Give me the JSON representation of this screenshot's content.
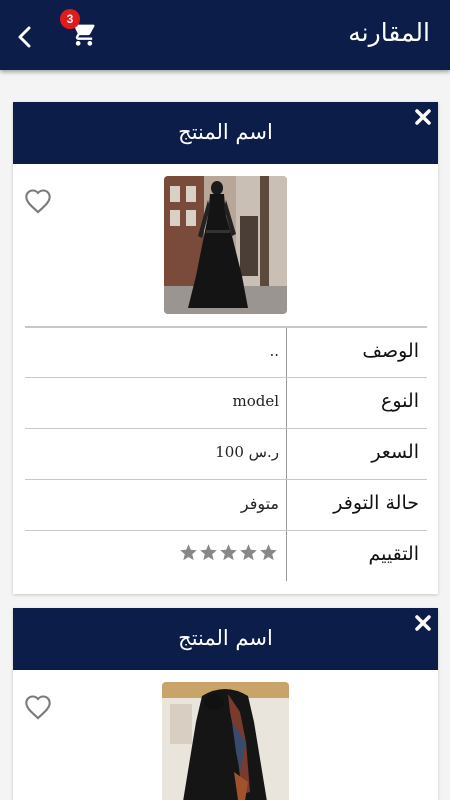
{
  "app_bar": {
    "title": "المقارنه",
    "cart_count": "3",
    "back_icon": "chevron-left-icon",
    "cart_icon": "cart-icon"
  },
  "colors": {
    "primary": "#0d1d4a",
    "badge": "#e01b1b",
    "star": "#888888"
  },
  "products": [
    {
      "title": "اسم المنتج",
      "specs": {
        "description_label": "الوصف",
        "description_value": "..",
        "type_label": "النوع",
        "type_value": "model",
        "price_label": "السعر",
        "price_value": "ر.س 100",
        "availability_label": "حالة التوفر",
        "availability_value": "متوفر",
        "rating_label": "التقييم",
        "rating": 5
      }
    },
    {
      "title": "اسم المنتج"
    }
  ]
}
